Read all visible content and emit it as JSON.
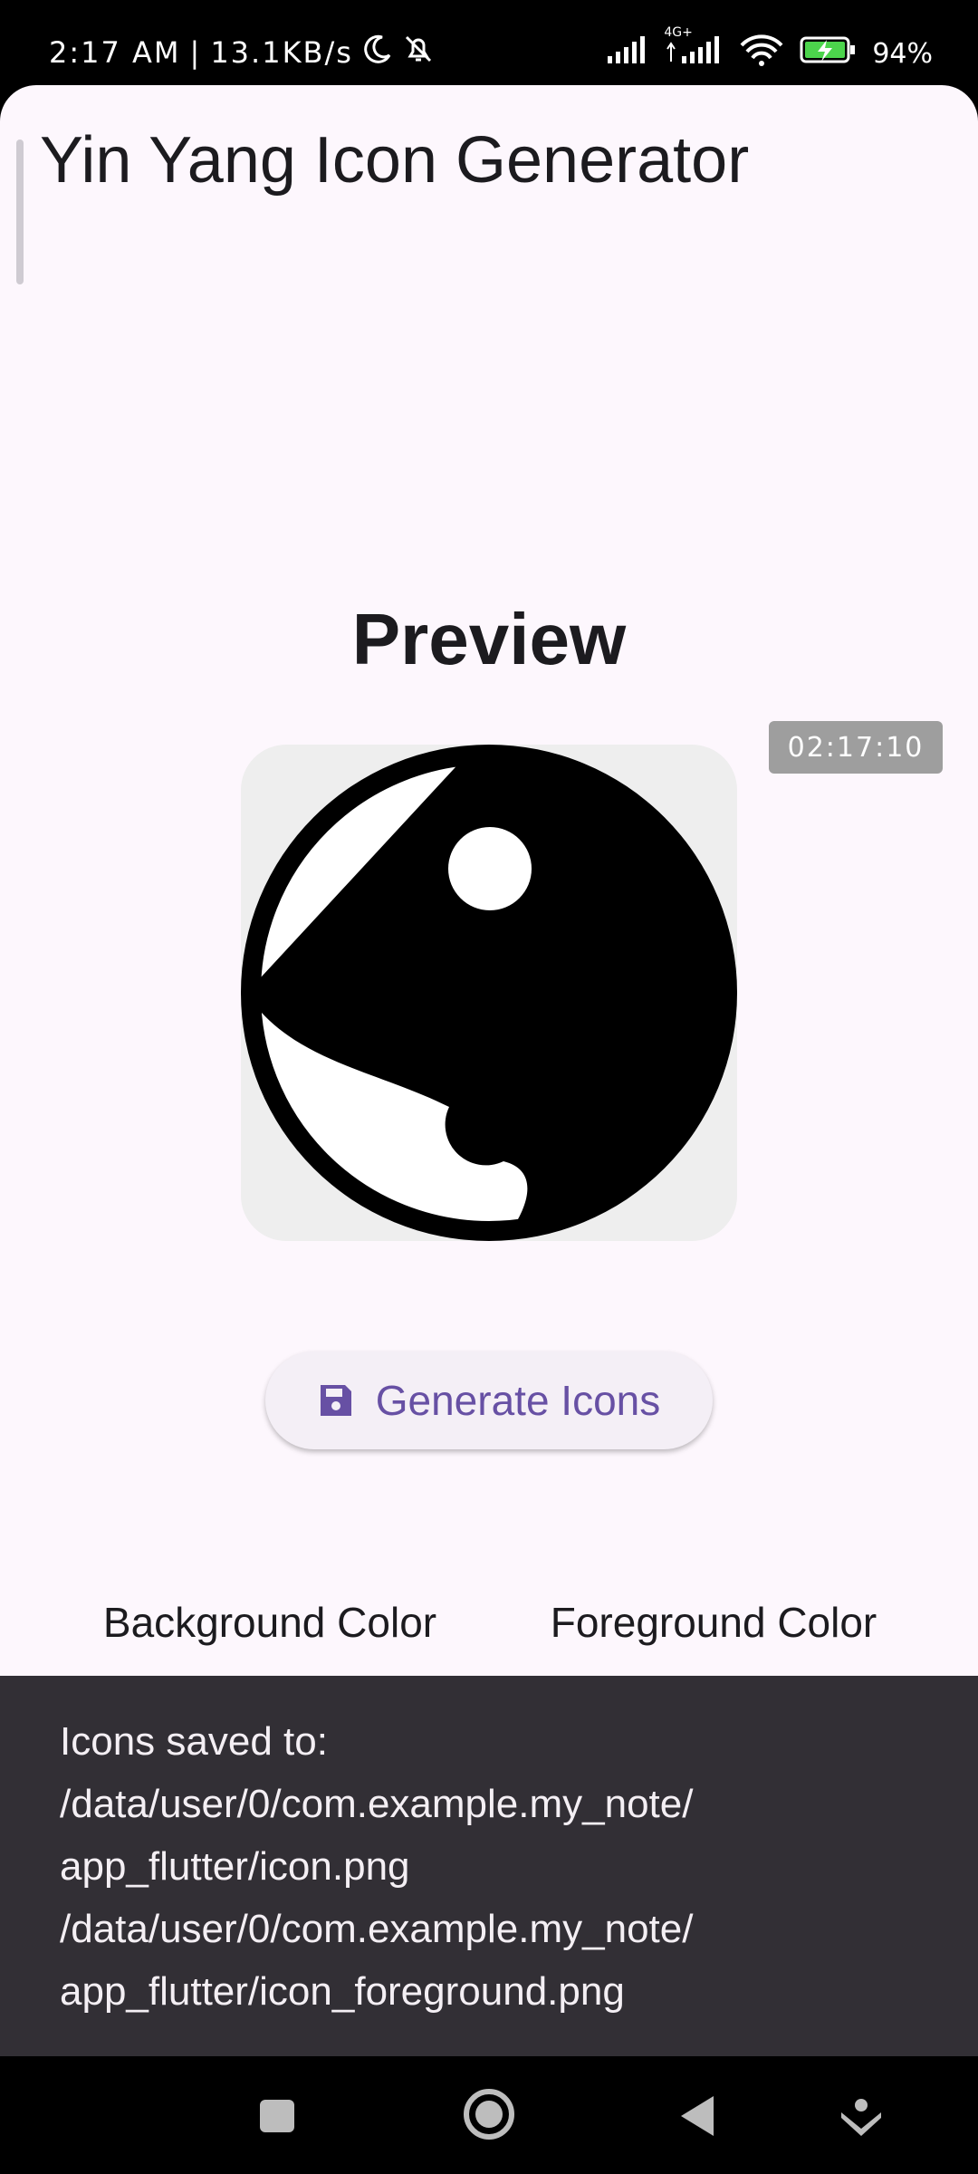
{
  "status_bar": {
    "time": "2:17 AM",
    "separator": "|",
    "speed": "13.1KB/s",
    "network": "4G+",
    "battery": "94%"
  },
  "app": {
    "title": "Yin Yang Icon Generator",
    "preview_heading": "Preview",
    "timestamp": "02:17:10",
    "generate_button": "Generate Icons",
    "background_label": "Background Color",
    "foreground_label": "Foreground Color",
    "background_color": "#FFFFFF",
    "foreground_color": "#000000",
    "accent_color": "#6750A4"
  },
  "snackbar": {
    "lines": [
      "Icons saved to:",
      "/data/user/0/com.example.my_note/",
      "app_flutter/icon.png",
      "/data/user/0/com.example.my_note/",
      "app_flutter/icon_foreground.png"
    ]
  },
  "nav": {
    "icons": [
      "square-icon",
      "home-circle-icon",
      "back-triangle-icon",
      "accessibility-icon"
    ]
  }
}
